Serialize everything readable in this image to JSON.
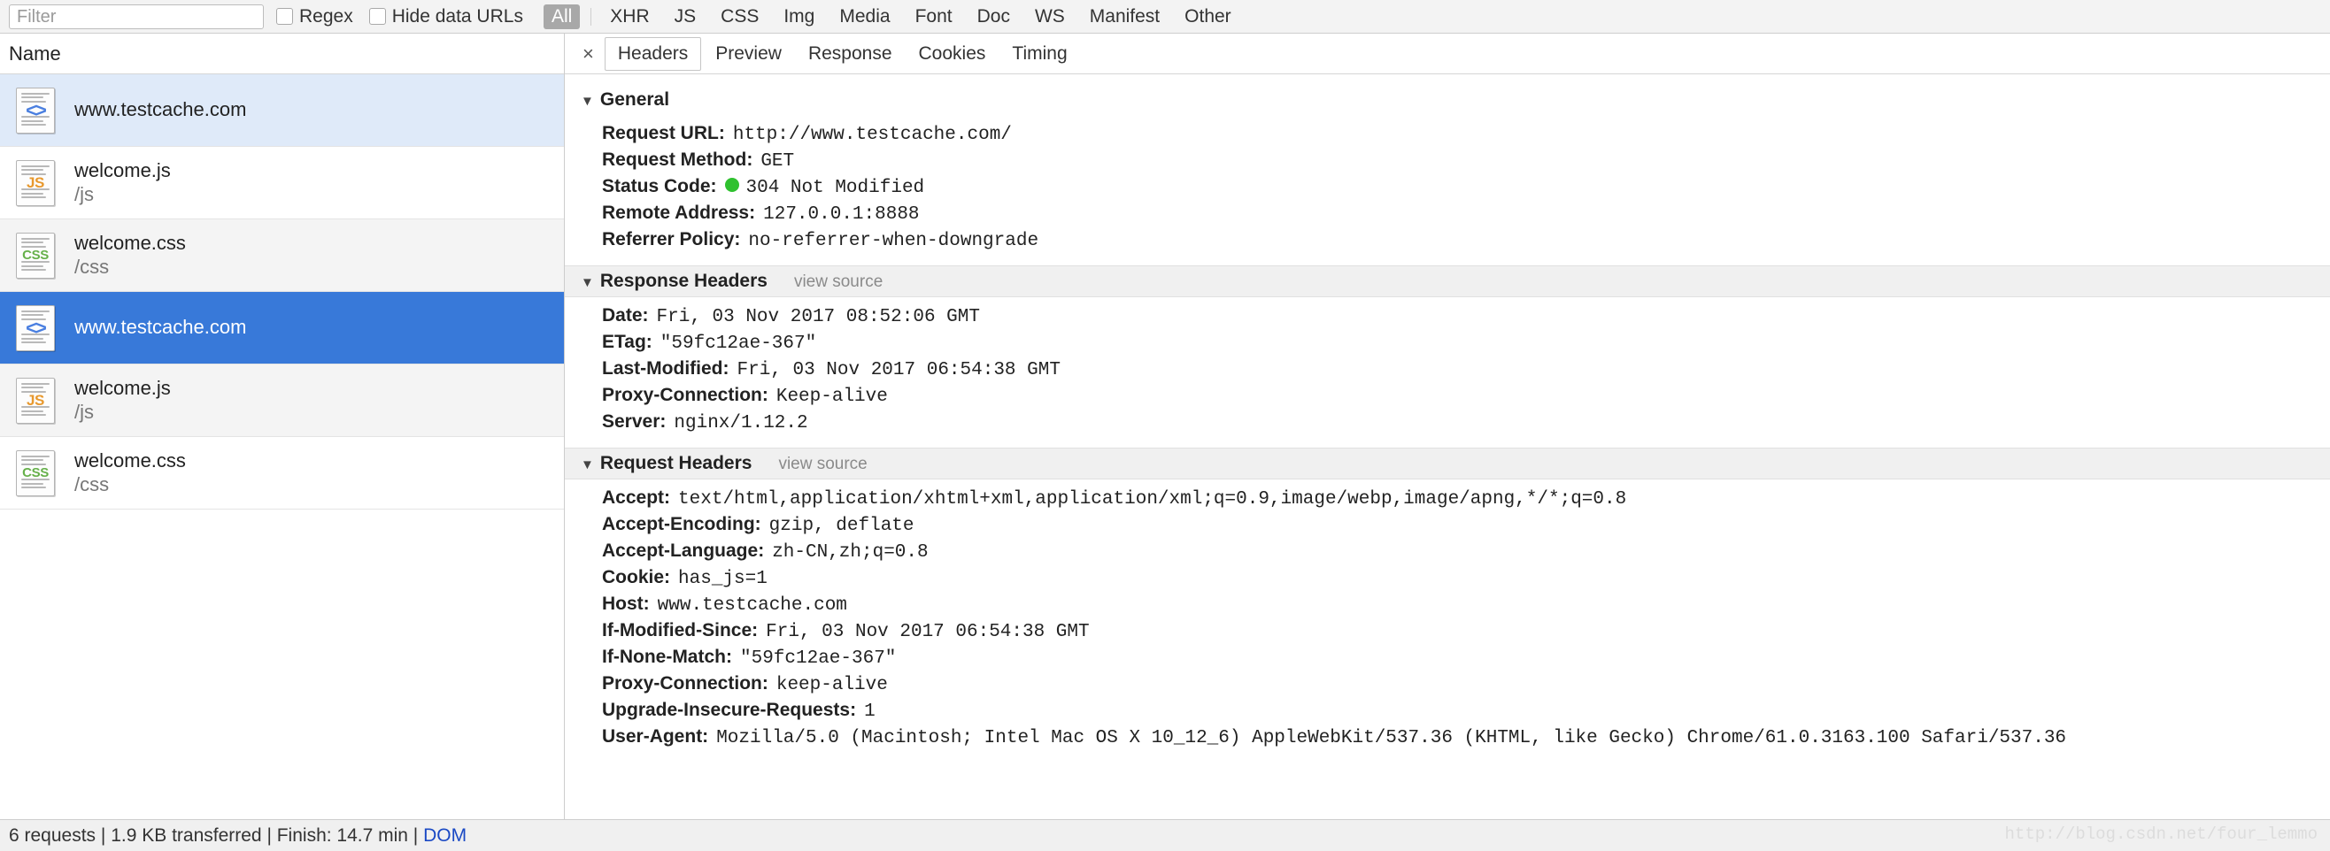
{
  "toolbar": {
    "filter_placeholder": "Filter",
    "regex_label": "Regex",
    "hide_data_urls_label": "Hide data URLs",
    "types": [
      {
        "label": "All",
        "active": true
      },
      {
        "label": "XHR",
        "active": false
      },
      {
        "label": "JS",
        "active": false
      },
      {
        "label": "CSS",
        "active": false
      },
      {
        "label": "Img",
        "active": false
      },
      {
        "label": "Media",
        "active": false
      },
      {
        "label": "Font",
        "active": false
      },
      {
        "label": "Doc",
        "active": false
      },
      {
        "label": "WS",
        "active": false
      },
      {
        "label": "Manifest",
        "active": false
      },
      {
        "label": "Other",
        "active": false
      }
    ]
  },
  "sidebar": {
    "column_header": "Name",
    "rows": [
      {
        "name": "www.testcache.com",
        "sub": "",
        "icon": "document-code-icon",
        "badge": "<>",
        "state": "highlighted"
      },
      {
        "name": "welcome.js",
        "sub": "/js",
        "icon": "javascript-file-icon",
        "badge": "JS",
        "state": "normal"
      },
      {
        "name": "welcome.css",
        "sub": "/css",
        "icon": "css-file-icon",
        "badge": "CSS",
        "state": "alt"
      },
      {
        "name": "www.testcache.com",
        "sub": "",
        "icon": "document-code-icon",
        "badge": "<>",
        "state": "selected"
      },
      {
        "name": "welcome.js",
        "sub": "/js",
        "icon": "javascript-file-icon",
        "badge": "JS",
        "state": "alt"
      },
      {
        "name": "welcome.css",
        "sub": "/css",
        "icon": "css-file-icon",
        "badge": "CSS",
        "state": "normal"
      }
    ]
  },
  "detail": {
    "close_label": "×",
    "tabs": [
      {
        "label": "Headers",
        "active": true
      },
      {
        "label": "Preview",
        "active": false
      },
      {
        "label": "Response",
        "active": false
      },
      {
        "label": "Cookies",
        "active": false
      },
      {
        "label": "Timing",
        "active": false
      }
    ],
    "view_source_label": "view source",
    "sections": [
      {
        "title": "General",
        "has_view_source": false,
        "rows": [
          {
            "key": "Request URL:",
            "value": "http://www.testcache.com/",
            "status_dot": false
          },
          {
            "key": "Request Method:",
            "value": "GET",
            "status_dot": false
          },
          {
            "key": "Status Code:",
            "value": "304 Not Modified",
            "status_dot": true
          },
          {
            "key": "Remote Address:",
            "value": "127.0.0.1:8888",
            "status_dot": false
          },
          {
            "key": "Referrer Policy:",
            "value": "no-referrer-when-downgrade",
            "status_dot": false
          }
        ]
      },
      {
        "title": "Response Headers",
        "has_view_source": true,
        "rows": [
          {
            "key": "Date:",
            "value": "Fri, 03 Nov 2017 08:52:06 GMT",
            "status_dot": false
          },
          {
            "key": "ETag:",
            "value": "\"59fc12ae-367\"",
            "status_dot": false
          },
          {
            "key": "Last-Modified:",
            "value": "Fri, 03 Nov 2017 06:54:38 GMT",
            "status_dot": false
          },
          {
            "key": "Proxy-Connection:",
            "value": "Keep-alive",
            "status_dot": false
          },
          {
            "key": "Server:",
            "value": "nginx/1.12.2",
            "status_dot": false
          }
        ]
      },
      {
        "title": "Request Headers",
        "has_view_source": true,
        "rows": [
          {
            "key": "Accept:",
            "value": "text/html,application/xhtml+xml,application/xml;q=0.9,image/webp,image/apng,*/*;q=0.8",
            "status_dot": false
          },
          {
            "key": "Accept-Encoding:",
            "value": "gzip, deflate",
            "status_dot": false
          },
          {
            "key": "Accept-Language:",
            "value": "zh-CN,zh;q=0.8",
            "status_dot": false
          },
          {
            "key": "Cookie:",
            "value": "has_js=1",
            "status_dot": false
          },
          {
            "key": "Host:",
            "value": "www.testcache.com",
            "status_dot": false
          },
          {
            "key": "If-Modified-Since:",
            "value": "Fri, 03 Nov 2017 06:54:38 GMT",
            "status_dot": false
          },
          {
            "key": "If-None-Match:",
            "value": "\"59fc12ae-367\"",
            "status_dot": false
          },
          {
            "key": "Proxy-Connection:",
            "value": "keep-alive",
            "status_dot": false
          },
          {
            "key": "Upgrade-Insecure-Requests:",
            "value": "1",
            "status_dot": false
          },
          {
            "key": "User-Agent:",
            "value": "Mozilla/5.0 (Macintosh; Intel Mac OS X 10_12_6) AppleWebKit/537.36 (KHTML, like Gecko) Chrome/61.0.3163.100 Safari/537.36",
            "status_dot": false
          }
        ]
      }
    ]
  },
  "statusbar": {
    "requests": "6 requests",
    "transferred": "1.9 KB transferred",
    "finish": "Finish: 14.7 min",
    "dom": "DOM",
    "separator": " | "
  },
  "watermark": "http://blog.csdn.net/four_lemmo",
  "colors": {
    "selection_blue": "#3879d9",
    "highlight_blue": "#dfeaf9",
    "status_ok_green": "#2fc12f",
    "link_blue": "#1a49c4",
    "js_orange": "#e8992e",
    "css_green": "#66b04a",
    "doc_blue": "#4a7fe0"
  }
}
